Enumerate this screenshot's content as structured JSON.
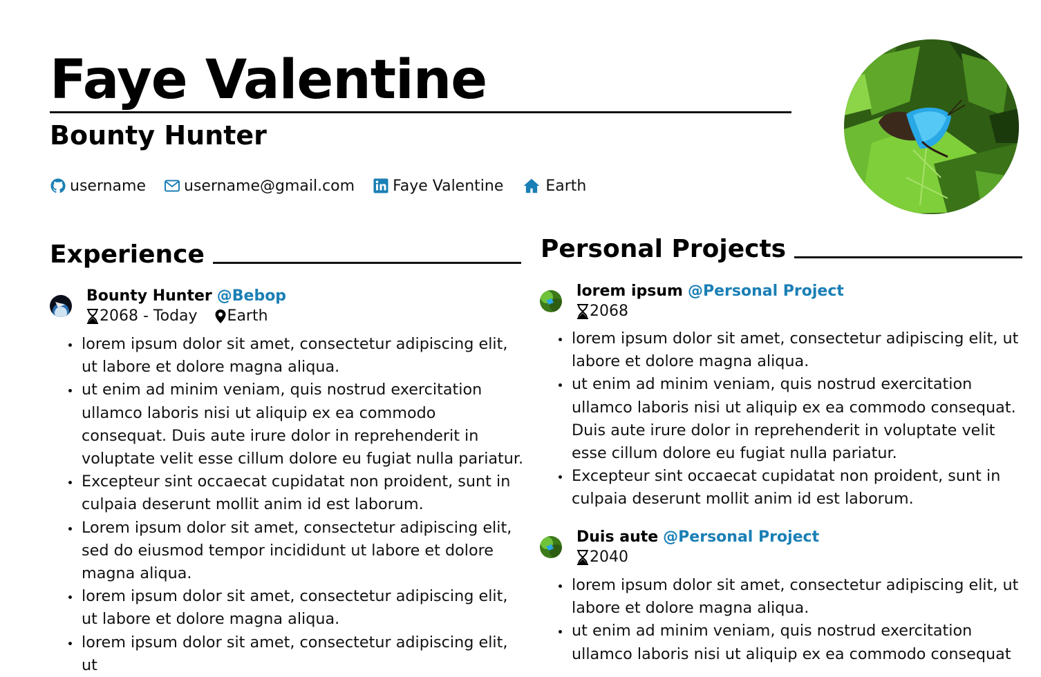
{
  "header": {
    "name": "Faye Valentine",
    "title": "Bounty Hunter"
  },
  "contacts": {
    "github": {
      "icon": "github-icon",
      "text": "username"
    },
    "email": {
      "icon": "mail-icon",
      "text": "username@gmail.com"
    },
    "linkedin": {
      "icon": "linkedin-icon",
      "text": "Faye Valentine"
    },
    "location": {
      "icon": "home-icon",
      "text": "Earth"
    }
  },
  "colors": {
    "accent": "#1a7fb5",
    "text": "#111111"
  },
  "experience": {
    "heading": "Experience",
    "entries": [
      {
        "role": "Bounty Hunter",
        "org": "@Bebop",
        "dates": "2068 - Today",
        "place": "Earth",
        "bullets": [
          "lorem ipsum dolor sit amet, consectetur adipiscing elit, ut labore et dolore magna aliqua.",
          "ut enim ad minim veniam, quis nostrud exercitation ullamco laboris nisi ut aliquip ex ea commodo consequat. Duis aute irure dolor in reprehenderit in voluptate velit esse cillum dolore eu fugiat nulla pariatur.",
          "Excepteur sint occaecat cupidatat non proident, sunt in culpaia deserunt mollit anim id est laborum.",
          "Lorem ipsum dolor sit amet, consectetur adipiscing elit, sed do eiusmod tempor incididunt ut labore et dolore magna aliqua.",
          "lorem ipsum dolor sit amet, consectetur adipiscing elit, ut labore et dolore magna aliqua.",
          "lorem ipsum dolor sit amet, consectetur adipiscing elit, ut"
        ]
      }
    ]
  },
  "projects": {
    "heading": "Personal Projects",
    "entries": [
      {
        "role": "lorem ipsum",
        "org": "@Personal Project",
        "dates": "2068",
        "bullets": [
          "lorem ipsum dolor sit amet, consectetur adipiscing elit, ut labore et dolore magna aliqua.",
          "ut enim ad minim veniam, quis nostrud exercitation ullamco laboris nisi ut aliquip ex ea commodo consequat. Duis aute irure dolor in reprehenderit in voluptate velit esse cillum dolore eu fugiat nulla pariatur.",
          "Excepteur sint occaecat cupidatat non proident, sunt in culpaia deserunt mollit anim id est laborum."
        ]
      },
      {
        "role": "Duis aute",
        "org": "@Personal Project",
        "dates": "2040",
        "bullets": [
          "lorem ipsum dolor sit amet, consectetur adipiscing elit, ut labore et dolore magna aliqua.",
          "ut enim ad minim veniam, quis nostrud exercitation ullamco laboris nisi ut aliquip ex ea commodo consequat"
        ]
      }
    ]
  }
}
